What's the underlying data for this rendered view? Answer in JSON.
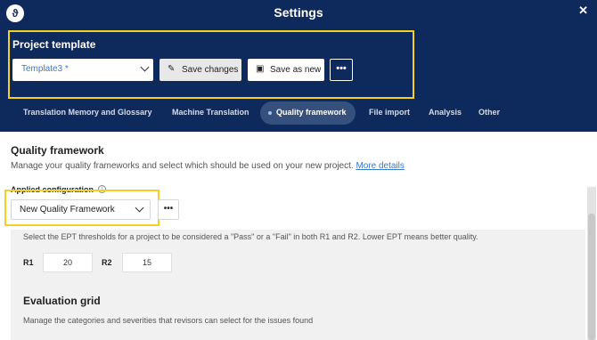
{
  "window": {
    "title": "Settings",
    "close_glyph": "✕",
    "logo_glyph": "ϑ"
  },
  "project_template": {
    "label": "Project template",
    "selected": "Template3 *",
    "save_changes_label": "Save changes",
    "save_as_new_label": "Save as new",
    "more_label": "•••"
  },
  "tabs": [
    {
      "label": "Translation Memory and Glossary"
    },
    {
      "label": "Machine Translation"
    },
    {
      "label": "Quality framework",
      "active": true
    },
    {
      "label": "File import"
    },
    {
      "label": "Analysis"
    },
    {
      "label": "Other"
    }
  ],
  "quality_framework": {
    "title": "Quality framework",
    "description": "Manage your quality frameworks and select which should be used on your new project.",
    "more_details_link": "More details",
    "applied_label": "Applied configuration",
    "applied_value": "New Quality Framework",
    "more_label": "•••"
  },
  "ept": {
    "description": "Select the EPT thresholds for a project to be considered a \"Pass\" or a \"Fail\" in both R1 and R2. Lower EPT means better quality.",
    "r1_label": "R1",
    "r1_value": "20",
    "r2_label": "R2",
    "r2_value": "15"
  },
  "evaluation_grid": {
    "title": "Evaluation grid",
    "description": "Manage the categories and severities that revisors can select for the issues found"
  },
  "colors": {
    "header_bg": "#0e2a5c",
    "highlight": "#f2d024",
    "link": "#3a78c8",
    "active_tab_bg": "#35507d"
  }
}
